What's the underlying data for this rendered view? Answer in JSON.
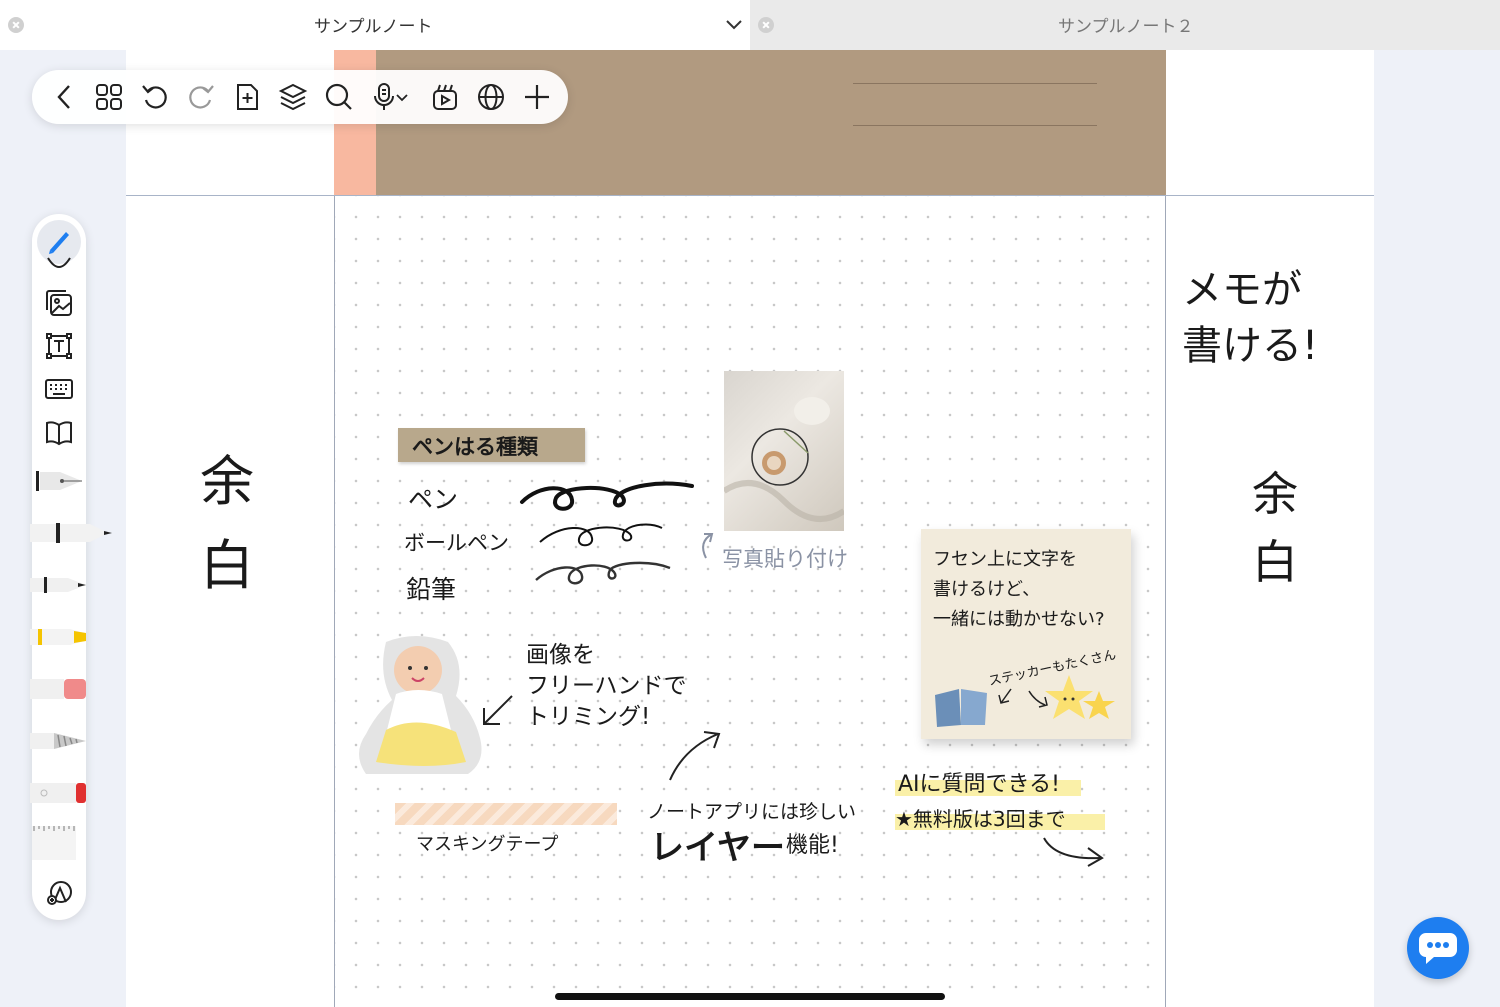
{
  "tabs": [
    {
      "title": "サンプルノート",
      "active": true
    },
    {
      "title": "サンプルノート２",
      "active": false
    }
  ],
  "toolbar": {
    "icons": [
      "back-icon",
      "grid-icon",
      "undo-icon",
      "redo-icon",
      "add-page-icon",
      "layers-icon",
      "search-icon",
      "microphone-icon",
      "chevron-down-icon",
      "media-icon",
      "globe-icon",
      "plus-icon"
    ]
  },
  "tool_panel": {
    "icons": [
      "pen-tool-icon",
      "lasso-icon",
      "image-icon",
      "textbox-icon",
      "keyboard-icon",
      "book-icon",
      "fountain-pen-icon",
      "ballpoint-pen-icon",
      "pencil-icon",
      "highlighter-icon",
      "eraser-icon",
      "brush-icon",
      "marker-icon",
      "ruler-icon",
      "shapes-icon"
    ],
    "accent": "#1e7ef0"
  },
  "note": {
    "left_margin": "余\n白",
    "right_margin": "余\n白",
    "right_memo": "メモが\n書ける!",
    "pen_types_title": "ペンはる種類",
    "pen_1": "ペン",
    "pen_2": "ボールペン",
    "pen_3": "鉛筆",
    "photo_caption": "写真貼り付け",
    "trim_note": "画像を\nフリーハンドで\nトリミング!",
    "masking_tape": "マスキングテープ",
    "layer_note_1": "ノートアプリには珍しい",
    "layer_note_2": "レイヤー",
    "layer_note_3": "機能!",
    "sticky_text": "フセン上に文字を\n書けるけど、\n一緒には動かせない?",
    "sticker_note": "ステッカーもたくさん",
    "ai_note_1": "AIに質問できる!",
    "ai_note_2": "★無料版は3回まで"
  },
  "colors": {
    "header_band": "#b19a80",
    "header_accent": "#f8b8a0",
    "fab": "#1e7ef0"
  }
}
